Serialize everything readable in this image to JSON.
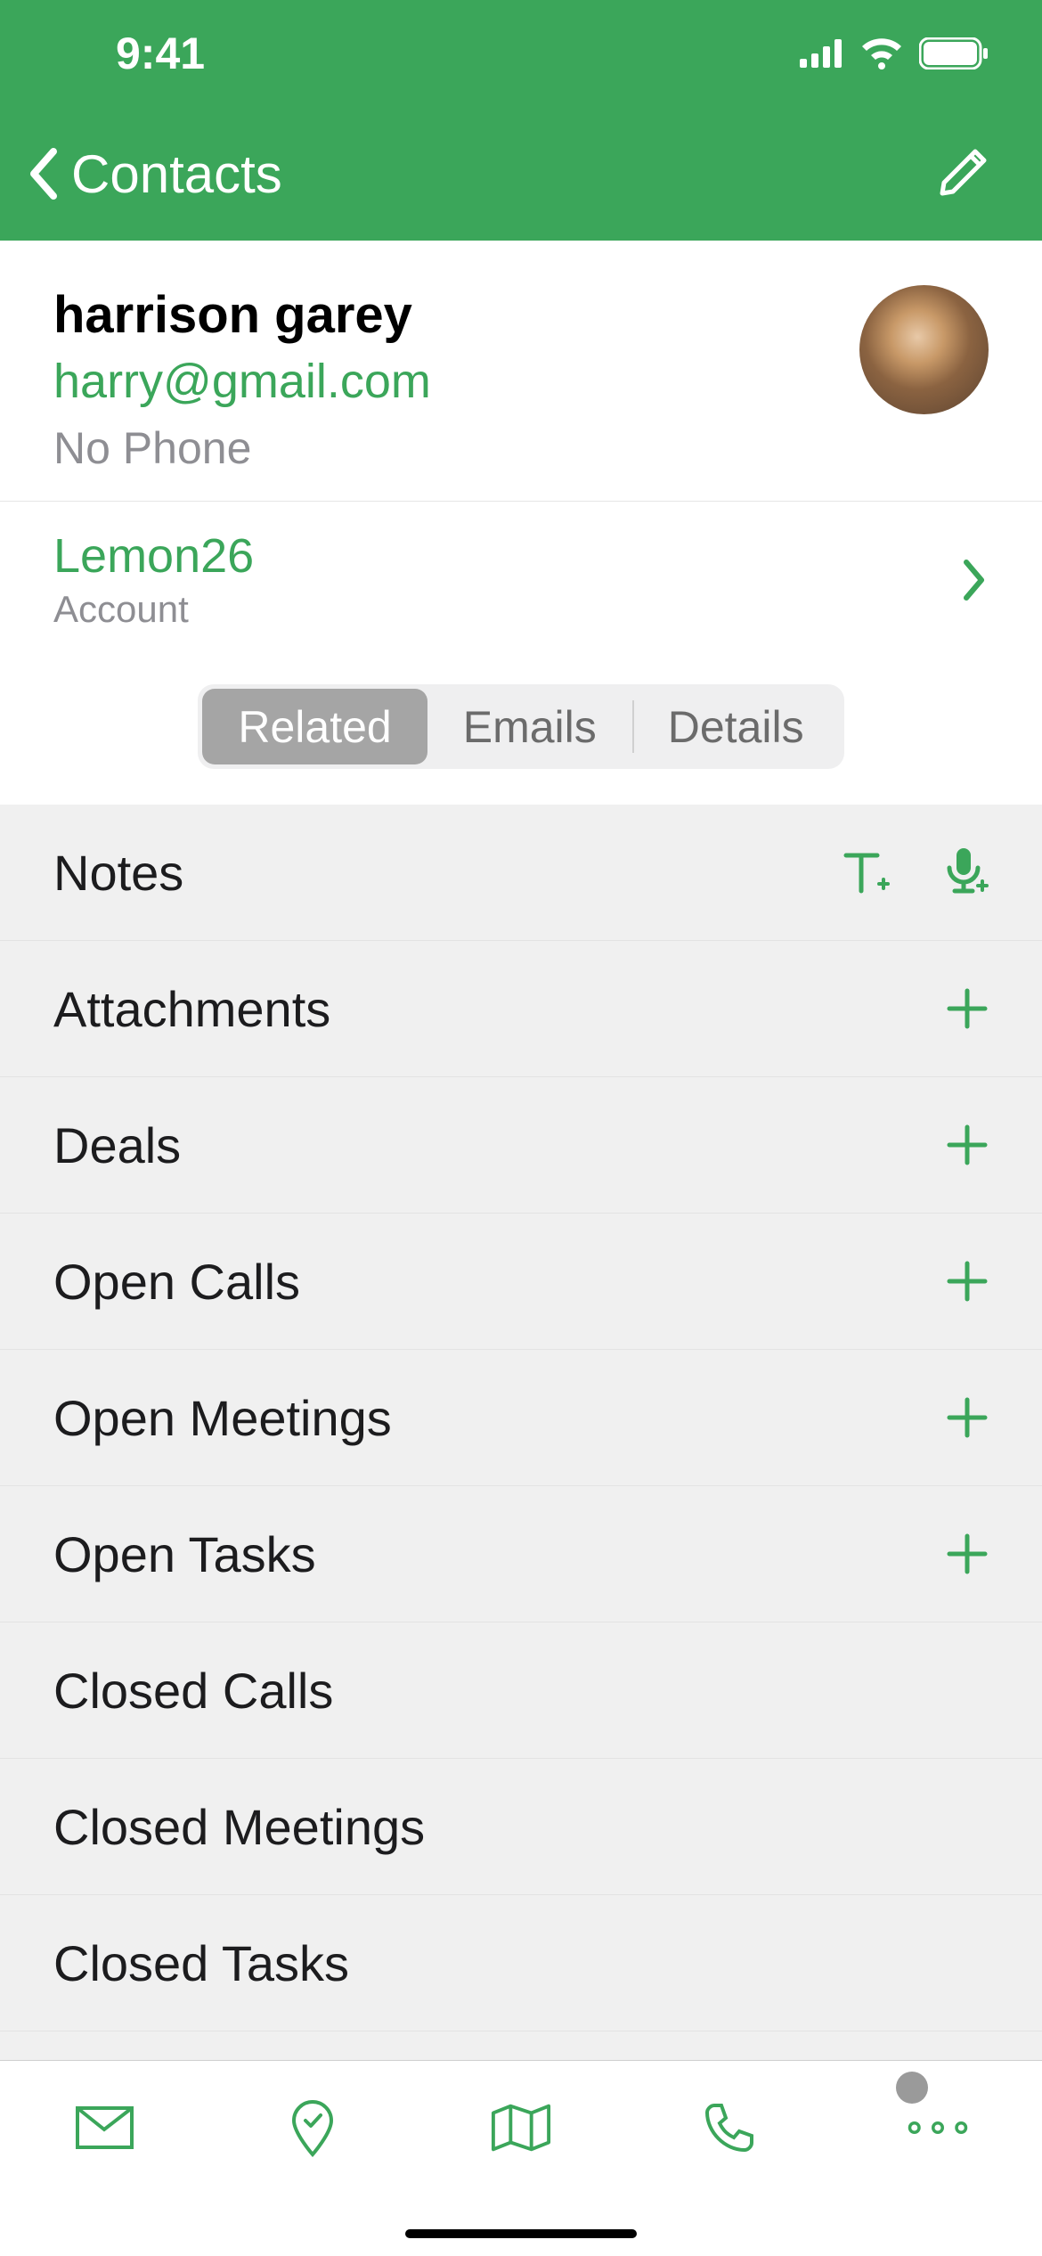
{
  "status": {
    "time": "9:41"
  },
  "nav": {
    "back_label": "Contacts"
  },
  "contact": {
    "name": "harrison garey",
    "email": "harry@gmail.com",
    "phone": "No Phone"
  },
  "account": {
    "name": "Lemon26",
    "label": "Account"
  },
  "tabs": {
    "related": "Related",
    "emails": "Emails",
    "details": "Details",
    "active": "related"
  },
  "sections": {
    "notes": "Notes",
    "attachments": "Attachments",
    "deals": "Deals",
    "open_calls": "Open Calls",
    "open_meetings": "Open Meetings",
    "open_tasks": "Open Tasks",
    "closed_calls": "Closed Calls",
    "closed_meetings": "Closed Meetings",
    "closed_tasks": "Closed Tasks"
  }
}
